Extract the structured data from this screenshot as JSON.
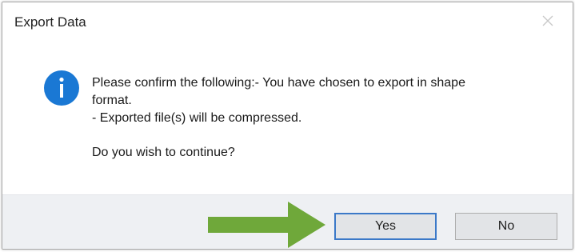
{
  "dialog": {
    "title": "Export Data",
    "close_icon": "close-icon",
    "info_icon": "info-icon",
    "message_lines": [
      "Please confirm the following:- You have chosen to export in shape",
      "format.",
      "- Exported file(s) will be compressed."
    ],
    "question": "Do you wish to continue?",
    "buttons": {
      "yes_label": "Yes",
      "no_label": "No"
    }
  },
  "annotation": {
    "arrow_icon": "arrow-right-icon",
    "arrow_color": "#6fa83a"
  },
  "colors": {
    "info_blue": "#1a78d4",
    "default_button_border": "#3b79c8",
    "footer_bg": "#eef0f3"
  }
}
